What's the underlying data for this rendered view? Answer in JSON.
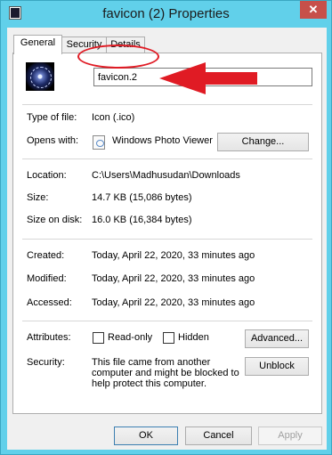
{
  "window": {
    "title": "favicon (2) Properties",
    "close_glyph": "✕"
  },
  "tabs": [
    {
      "label": "General",
      "active": true
    },
    {
      "label": "Security",
      "active": false
    },
    {
      "label": "Details",
      "active": false
    }
  ],
  "general": {
    "file_name": "favicon.2",
    "type_label": "Type of file:",
    "type_value": "Icon (.ico)",
    "opens_label": "Opens with:",
    "opens_value": "Windows Photo Viewer",
    "change_button": "Change...",
    "location_label": "Location:",
    "location_value": "C:\\Users\\Madhusudan\\Downloads",
    "size_label": "Size:",
    "size_value": "14.7 KB (15,086 bytes)",
    "size_disk_label": "Size on disk:",
    "size_disk_value": "16.0 KB (16,384 bytes)",
    "created_label": "Created:",
    "created_value": "Today, April 22, 2020, 33 minutes ago",
    "modified_label": "Modified:",
    "modified_value": "Today, April 22, 2020, 33 minutes ago",
    "accessed_label": "Accessed:",
    "accessed_value": "Today, April 22, 2020, 33 minutes ago",
    "attributes_label": "Attributes:",
    "readonly_label": "Read-only",
    "readonly_checked": false,
    "hidden_label": "Hidden",
    "hidden_checked": false,
    "advanced_button": "Advanced...",
    "security_label": "Security:",
    "security_text": "This file came from another computer and might be blocked to help protect this computer.",
    "unblock_button": "Unblock"
  },
  "footer": {
    "ok": "OK",
    "cancel": "Cancel",
    "apply": "Apply"
  },
  "icons": {
    "app": "app-icon",
    "file": "favicon-thumbnail-icon",
    "photo_viewer": "photo-viewer-icon"
  },
  "colors": {
    "frame": "#61d0ea",
    "close": "#c7504a",
    "annotation": "#e01b24"
  }
}
